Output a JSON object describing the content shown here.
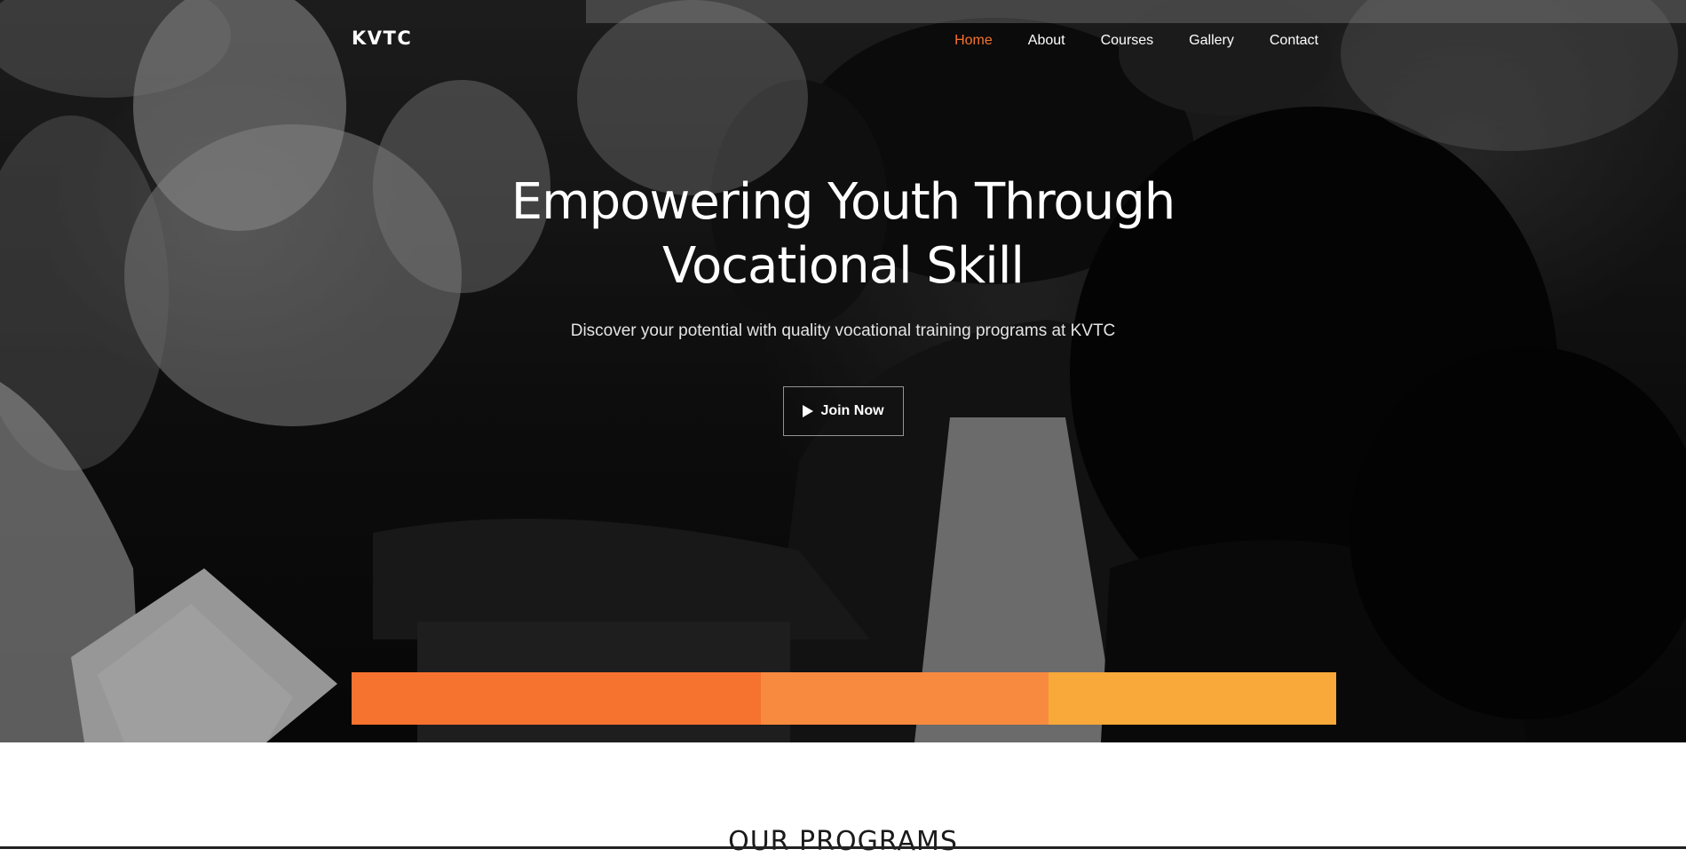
{
  "nav": {
    "brand": "KVTC",
    "links": [
      {
        "label": "Home",
        "active": true
      },
      {
        "label": "About",
        "active": false
      },
      {
        "label": "Courses",
        "active": false
      },
      {
        "label": "Gallery",
        "active": false
      },
      {
        "label": "Contact",
        "active": false
      }
    ]
  },
  "hero": {
    "title": "Empowering Youth Through Vocational Skill",
    "subtitle": "Discover your potential with quality vocational training programs at KVTC",
    "cta_label": "Join Now",
    "cta_icon": "play-icon"
  },
  "color_bar": {
    "segments": [
      "#f6722f",
      "#f78a3e",
      "#f9a83a"
    ]
  },
  "programs": {
    "title": "OUR PROGRAMS"
  },
  "colors": {
    "accent": "#f6722f",
    "hero_text": "#ffffff"
  }
}
